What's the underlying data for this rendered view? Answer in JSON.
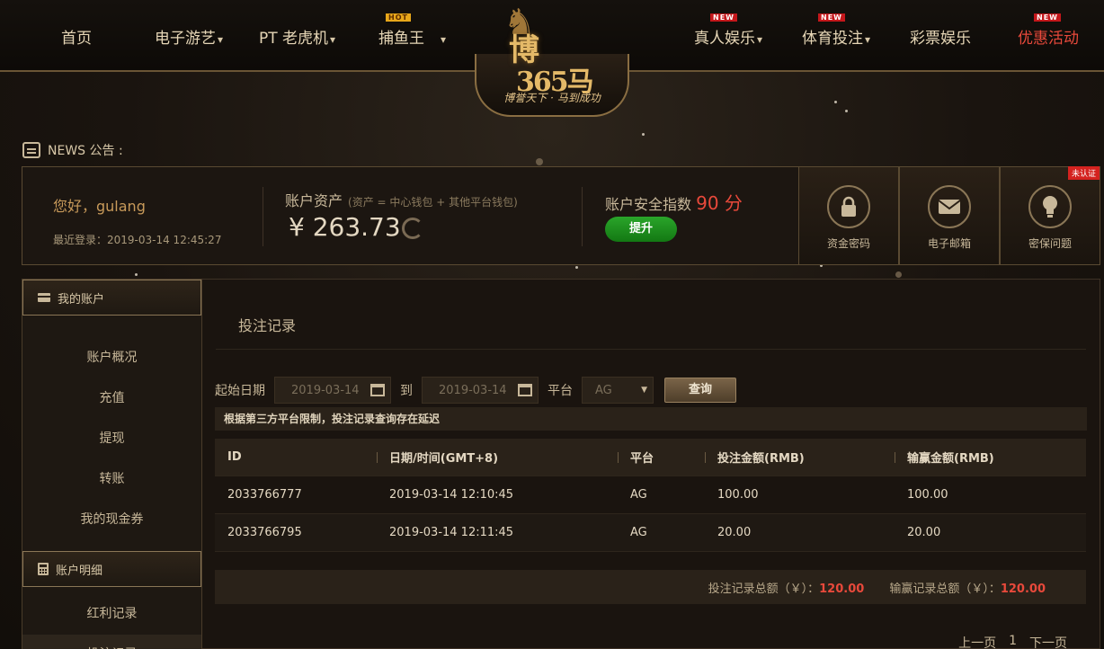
{
  "nav": {
    "items": [
      {
        "label": "首页",
        "chevron": false,
        "badge": ""
      },
      {
        "label": "电子游艺",
        "chevron": true,
        "badge": ""
      },
      {
        "label": "PT 老虎机",
        "chevron": true,
        "badge": ""
      },
      {
        "label": "捕鱼王",
        "chevron": true,
        "badge": "HOT"
      },
      {
        "label": "真人娱乐",
        "chevron": true,
        "badge": "NEW"
      },
      {
        "label": "体育投注",
        "chevron": true,
        "badge": "NEW"
      },
      {
        "label": "彩票娱乐",
        "chevron": false,
        "badge": ""
      },
      {
        "label": "优惠活动",
        "chevron": false,
        "badge": "NEW"
      }
    ]
  },
  "logo": {
    "main": "博",
    "num": "365马",
    "slogan": "博誉天下 · 马到成功"
  },
  "news": {
    "label": "NEWS 公告 :"
  },
  "account": {
    "greeting": "您好，gulang",
    "last_login": "最近登录：2019-03-14 12:45:27",
    "asset_title": "账户资产",
    "asset_note": "(资产 = 中心钱包 + 其他平台钱包)",
    "asset_amount": "¥ 263.73",
    "security_title": "账户安全指数",
    "security_score": "90 分",
    "upgrade_label": "提升",
    "unverified": "未认证",
    "security_boxes": [
      {
        "label": "资金密码",
        "icon": "lock-icon"
      },
      {
        "label": "电子邮箱",
        "icon": "mail-icon"
      },
      {
        "label": "密保问题",
        "icon": "bulb-icon"
      }
    ]
  },
  "sidebar": {
    "section1": "我的账户",
    "items1": [
      "账户概况",
      "充值",
      "提现",
      "转账",
      "我的现金券"
    ],
    "section2": "账户明细",
    "items2": [
      "红利记录",
      "投注记录"
    ]
  },
  "main": {
    "title": "投注记录",
    "filter": {
      "start_label": "起始日期",
      "start_value": "2019-03-14",
      "to_label": "到",
      "end_value": "2019-03-14",
      "platform_label": "平台",
      "platform_value": "AG",
      "query_label": "查询"
    },
    "notice": "根据第三方平台限制，投注记录查询存在延迟",
    "table": {
      "headers": [
        "ID",
        "日期/时间(GMT+8)",
        "平台",
        "投注金额(RMB)",
        "输赢金额(RMB)"
      ],
      "rows": [
        [
          "2033766777",
          "2019-03-14 12:10:45",
          "AG",
          "100.00",
          "100.00"
        ],
        [
          "2033766795",
          "2019-03-14 12:11:45",
          "AG",
          "20.00",
          "20.00"
        ]
      ]
    },
    "summary": {
      "bet_label": "投注记录总额（￥）：",
      "bet_value": "120.00",
      "win_label": "输赢记录总额（￥）：",
      "win_value": "120.00"
    },
    "pager": {
      "prev": "上一页",
      "page": "1",
      "next": "下一页"
    }
  }
}
